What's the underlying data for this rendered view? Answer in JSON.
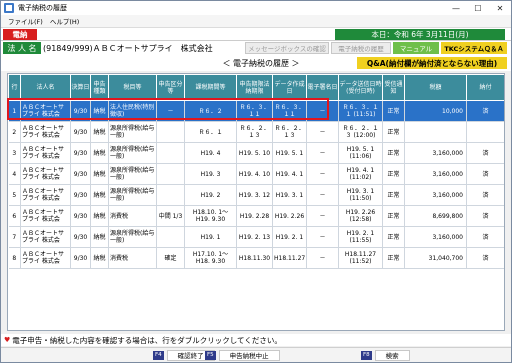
{
  "window": {
    "title": "電子納税の履歴",
    "controls": {
      "minimize": "—",
      "maximize": "☐",
      "close": "✕"
    }
  },
  "menu": [
    "ファイル(F)",
    "ヘルプ(H)"
  ],
  "header": {
    "tag": "電納",
    "date_text": "本日：令和 6年 3月11日(月)",
    "corp_label": "法 人 名",
    "corp_name": "(91849/999)ＡＢＣオートサプライ　株式会社",
    "tabs": {
      "message_box": "メッセージボックスの確認",
      "history": "電子納税の履歴",
      "manual": "マニュアル",
      "qa": "TKCシステムＱ＆Ａ"
    },
    "section_title": "＜ 電子納税の履歴 ＞",
    "qa_note": "Q&A(納付欄が納付済とならない理由)"
  },
  "table": {
    "columns": [
      "行",
      "法人名",
      "決算日",
      "申告種類",
      "税目等",
      "申告区分等",
      "課税期間等",
      "申告期限法納期限",
      "データ作成日",
      "電子署名日",
      "データ送信日時(受付日時)",
      "受信通知",
      "税額",
      "納付"
    ],
    "rows": [
      {
        "no": "1",
        "name": "ＡＢＣオートサプライ 株式会",
        "kessan": "9/30",
        "kind": "納税",
        "tax": "法人住民税(特別徴収)",
        "kubun": "－",
        "period": "Ｒ６．２",
        "deadline": "Ｒ６．３．１１",
        "created": "Ｒ６．３．１１",
        "sign": "－",
        "sent": "Ｒ６．３．１１ (11:51)",
        "recv": "正常",
        "amount": "10,000",
        "paid": "済"
      },
      {
        "no": "2",
        "name": "ＡＢＣオートサプライ 株式会",
        "kessan": "9/30",
        "kind": "納税",
        "tax": "源泉所得税(給与一般)",
        "kubun": "",
        "period": "Ｒ６．１",
        "deadline": "Ｒ６．２．１３",
        "created": "Ｒ６．２．１３",
        "sign": "－",
        "sent": "Ｒ６．２．１３ (12:00)",
        "recv": "正常",
        "amount": "",
        "paid": ""
      },
      {
        "no": "3",
        "name": "ＡＢＣオートサプライ 株式会",
        "kessan": "9/30",
        "kind": "納税",
        "tax": "源泉所得税(給与一般)",
        "kubun": "",
        "period": "H19. 4",
        "deadline": "H19. 5. 10",
        "created": "H19. 5. 1",
        "sign": "－",
        "sent": "H19. 5. 1 (11:06)",
        "recv": "正常",
        "amount": "3,160,000",
        "paid": "済"
      },
      {
        "no": "4",
        "name": "ＡＢＣオートサプライ 株式会",
        "kessan": "9/30",
        "kind": "納税",
        "tax": "源泉所得税(給与一般)",
        "kubun": "",
        "period": "H19. 3",
        "deadline": "H19. 4. 10",
        "created": "H19. 4. 1",
        "sign": "－",
        "sent": "H19. 4. 1 (11:02)",
        "recv": "正常",
        "amount": "3,160,000",
        "paid": "済"
      },
      {
        "no": "5",
        "name": "ＡＢＣオートサプライ 株式会",
        "kessan": "9/30",
        "kind": "納税",
        "tax": "源泉所得税(給与一般)",
        "kubun": "",
        "period": "H19. 2",
        "deadline": "H19. 3. 12",
        "created": "H19. 3. 1",
        "sign": "－",
        "sent": "H19. 3. 1 (11:50)",
        "recv": "正常",
        "amount": "3,160,000",
        "paid": "済"
      },
      {
        "no": "6",
        "name": "ＡＢＣオートサプライ 株式会",
        "kessan": "9/30",
        "kind": "納税",
        "tax": "消費税",
        "kubun": "中間 1/3",
        "period": "H18.10. 1～H19. 9.30",
        "deadline": "H19. 2.28",
        "created": "H19. 2.26",
        "sign": "－",
        "sent": "H19. 2.26 (12:58)",
        "recv": "正常",
        "amount": "8,699,800",
        "paid": "済"
      },
      {
        "no": "7",
        "name": "ＡＢＣオートサプライ 株式会",
        "kessan": "9/30",
        "kind": "納税",
        "tax": "源泉所得税(給与一般)",
        "kubun": "",
        "period": "H19. 1",
        "deadline": "H19. 2. 13",
        "created": "H19. 2. 1",
        "sign": "－",
        "sent": "H19. 2. 1 (11:55)",
        "recv": "正常",
        "amount": "3,160,000",
        "paid": "済"
      },
      {
        "no": "8",
        "name": "ＡＢＣオートサプライ 株式会",
        "kessan": "9/30",
        "kind": "納税",
        "tax": "消費税",
        "kubun": "確定",
        "period": "H17.10. 1～H18. 9.30",
        "deadline": "H18.11.30",
        "created": "H18.11.27",
        "sign": "－",
        "sent": "H18.11.27 (11:52)",
        "recv": "正常",
        "amount": "31,040,700",
        "paid": "済"
      }
    ]
  },
  "status_text": "電子申告・納税した内容を確認する場合は、行をダブルクリックしてください。",
  "fkeys": [
    {
      "key": "F4",
      "label": "確認終了"
    },
    {
      "key": "F5",
      "label": "申告納税中止"
    },
    {
      "key": "F8",
      "label": "検索"
    }
  ]
}
